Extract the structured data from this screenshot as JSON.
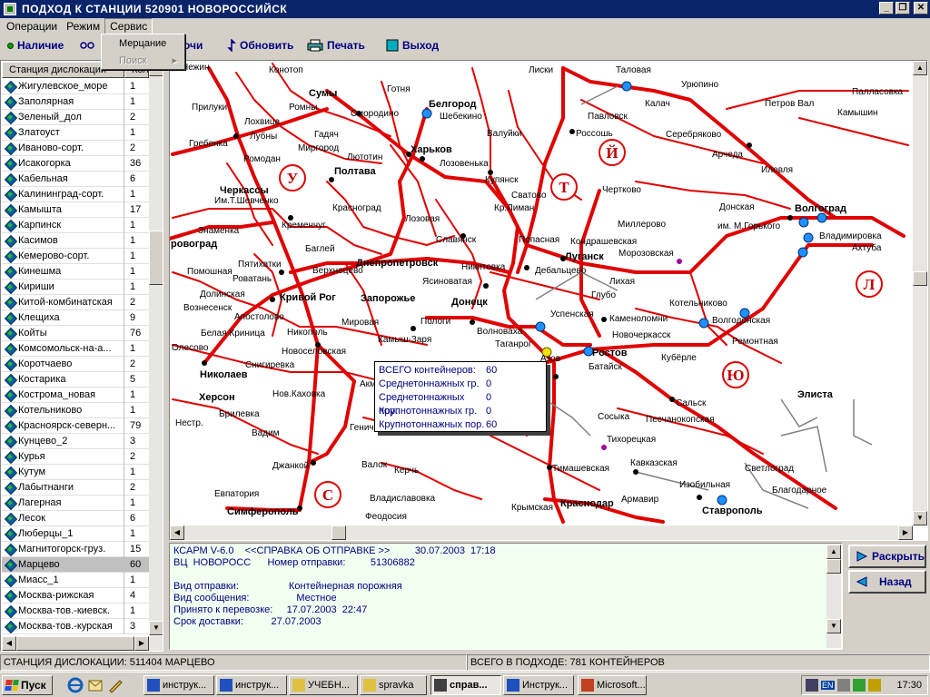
{
  "window": {
    "title": "ПОДХОД К СТАНЦИИ 520901   НОВОРОССИЙСК"
  },
  "menu": [
    "Операции",
    "Режим",
    "Сервис"
  ],
  "dropdown": {
    "items": [
      "Мерцание",
      "Поиск"
    ]
  },
  "toolbar": {
    "presence": "Наличие",
    "points_fragment": "очи",
    "refresh": "Обновить",
    "print": "Печать",
    "exit": "Выход"
  },
  "list": {
    "headers": [
      "Станция дислокации",
      "Кол"
    ],
    "rows": [
      {
        "name": "Жигулевское_море",
        "count": "1"
      },
      {
        "name": "Заполярная",
        "count": "1"
      },
      {
        "name": "Зеленый_дол",
        "count": "2"
      },
      {
        "name": "Златоуст",
        "count": "1"
      },
      {
        "name": "Иваново-сорт.",
        "count": "2"
      },
      {
        "name": "Исакогорка",
        "count": "36"
      },
      {
        "name": "Кабельная",
        "count": "6"
      },
      {
        "name": "Калининград-сорт.",
        "count": "1"
      },
      {
        "name": "Камышта",
        "count": "17"
      },
      {
        "name": "Карпинск",
        "count": "1"
      },
      {
        "name": "Касимов",
        "count": "1"
      },
      {
        "name": "Кемерово-сорт.",
        "count": "1"
      },
      {
        "name": "Кинешма",
        "count": "1"
      },
      {
        "name": "Кириши",
        "count": "1"
      },
      {
        "name": "Китой-комбинатская",
        "count": "2"
      },
      {
        "name": "Клещиха",
        "count": "9"
      },
      {
        "name": "Койты",
        "count": "76"
      },
      {
        "name": "Комсомольск-на-а...",
        "count": "1"
      },
      {
        "name": "Коротчаево",
        "count": "2"
      },
      {
        "name": "Костарика",
        "count": "5"
      },
      {
        "name": "Кострома_новая",
        "count": "1"
      },
      {
        "name": "Котельниково",
        "count": "1"
      },
      {
        "name": "Красноярск-северн...",
        "count": "79"
      },
      {
        "name": "Кунцево_2",
        "count": "3"
      },
      {
        "name": "Курья",
        "count": "2"
      },
      {
        "name": "Кутум",
        "count": "1"
      },
      {
        "name": "Лабытнанги",
        "count": "2"
      },
      {
        "name": "Лагерная",
        "count": "1"
      },
      {
        "name": "Лесок",
        "count": "6"
      },
      {
        "name": "Люберцы_1",
        "count": "1"
      },
      {
        "name": "Магнитогорск-груз.",
        "count": "15"
      },
      {
        "name": "Марцево",
        "count": "60",
        "selected": true
      },
      {
        "name": "Миасс_1",
        "count": "1"
      },
      {
        "name": "Москва-рижская",
        "count": "4"
      },
      {
        "name": "Москва-тов.-киевск.",
        "count": "1"
      },
      {
        "name": "Москва-тов.-курская",
        "count": "3"
      }
    ]
  },
  "map": {
    "cities": [
      {
        "t": "Сумы",
        "b": true
      },
      {
        "t": "Белгород",
        "b": true
      },
      {
        "t": "Харьков",
        "b": true
      },
      {
        "t": "Полтава",
        "b": true
      },
      {
        "t": "Черкассы",
        "b": true
      },
      {
        "t": "Днепропетровск",
        "b": true
      },
      {
        "t": "Запорожье",
        "b": true
      },
      {
        "t": "Кривой Рог",
        "b": true
      },
      {
        "t": "Николаев",
        "b": true
      },
      {
        "t": "Херсон",
        "b": true
      },
      {
        "t": "Луганск",
        "b": true
      },
      {
        "t": "Донецк",
        "b": true
      },
      {
        "t": "Ростов",
        "b": true
      },
      {
        "t": "Волгоград",
        "b": true
      },
      {
        "t": "Элиста",
        "b": true
      },
      {
        "t": "Ставрополь",
        "b": true
      },
      {
        "t": "Краснодар",
        "b": true
      },
      {
        "t": "Симферополь",
        "b": true
      },
      {
        "t": "ровоград",
        "b": true
      }
    ],
    "towns": [
      "Нежин",
      "Конотоп",
      "Лиски",
      "Таловая",
      "Урюпино",
      "Палласовка",
      "Готня",
      "Прилуки",
      "Ромны",
      "Смородино",
      "Шебекино",
      "Калач",
      "Петров Вал",
      "Камышин",
      "Лохвица",
      "Лубны",
      "Гадяч",
      "Валуйки",
      "Россошь",
      "Павловск",
      "Серебряково",
      "Гребенка",
      "Миргород",
      "Лозовенька",
      "Арчеда",
      "Ромодан",
      "Лютотин",
      "Иловля",
      "Купянск",
      "Чертково",
      "Им.Т.Шевченко",
      "Сватово",
      "Кременчуг",
      "Красноград",
      "Кр.Лиман",
      "Донская",
      "Миллерово",
      "им. М.Горького",
      "Знаменка",
      "Лозовая",
      "Владимировка",
      "Ахтуба",
      "Славянск",
      "Попасная",
      "Кондрашевская",
      "Морозовская",
      "Баглей",
      "Пятихатки",
      "Верхнецево",
      "Никитовка",
      "Дебальцево",
      "Помошная",
      "Роватань",
      "Ясиноватая",
      "Лихая",
      "Долинская",
      "Глубо",
      "Котельниково",
      "Вознесенск",
      "Апостолово",
      "Мировая",
      "Пологи",
      "Успенская",
      "Каменоломни",
      "Волгодонская",
      "Белая Криница",
      "Никополь",
      "Волноваха",
      "Новочеркасск",
      "Ремонтная",
      "Камыш-Заря",
      "Таганрог",
      "Азов",
      "Новоселовская",
      "Батайск",
      "Кубёрле",
      "Снигиревка",
      "Акм",
      "Нов.Каховка",
      "Сальск",
      "Брилевка",
      "Сосыка",
      "Песчанокопская",
      "Генич",
      "Вадим",
      "Тихорецкая",
      "Джанкой",
      "Валок",
      "Кавказская",
      "Светлоград",
      "Керчь",
      "Тимашевская",
      "Изобильная",
      "Благодарное",
      "Евпатория",
      "Владиславовка",
      "Армавир",
      "Феодосия",
      "Крымская",
      "Олесово",
      "Нестр."
    ],
    "regions": [
      "У",
      "Т",
      "Й",
      "Л",
      "Ю",
      "С"
    ]
  },
  "popup": {
    "rows": [
      {
        "label": "ВСЕГО контейнеров:",
        "value": "60"
      },
      {
        "label": "Среднетоннажных гр.",
        "value": "0"
      },
      {
        "label": "Среднетоннажных пор.",
        "value": "0"
      },
      {
        "label": "Крупнотоннажных гр.",
        "value": "0"
      },
      {
        "label": "Крупнотоннажных пор.",
        "value": "60"
      }
    ]
  },
  "info": {
    "lines": [
      "КСАРМ V-6.0    <<СПРАВКА ОБ ОТПРАВКЕ >>         30.07.2003  17:18",
      "ВЦ  НОВОРОСС      Номер отправки:         51306882",
      "",
      "Вид отправки:                  Контейнерная порожняя",
      "Вид сообщения:                 Местное",
      "Принято к перевозке:     17.07.2003  22:47",
      "Срок доставки:          27.07.2003"
    ]
  },
  "side_buttons": {
    "expand": "Раскрыть",
    "back": "Назад"
  },
  "status": {
    "left": "СТАНЦИЯ ДИСЛОКАЦИИ:   511404  МАРЦЕВО",
    "right": "ВСЕГО В ПОДХОДЕ: 781 КОНТЕЙНЕРОВ"
  },
  "taskbar": {
    "start": "Пуск",
    "tasks": [
      "инструк...",
      "инструк...",
      "УЧЕБН...",
      "spravka",
      "справ...",
      "Инструк...",
      "Microsoft..."
    ],
    "lang": "EN",
    "clock": "17:30"
  }
}
